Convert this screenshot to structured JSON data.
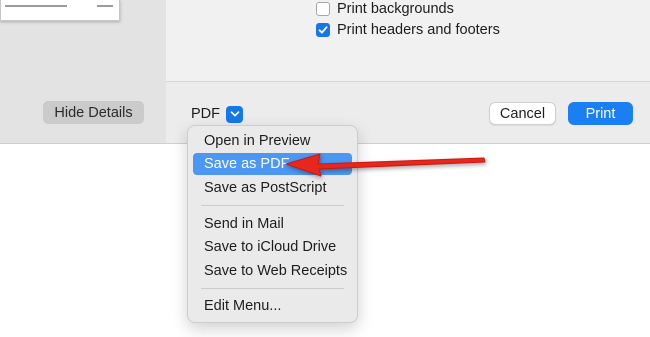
{
  "print_options": {
    "items": [
      {
        "label": "Print backgrounds",
        "checked": false
      },
      {
        "label": "Print headers and footers",
        "checked": true
      }
    ]
  },
  "footer": {
    "hide_details_label": "Hide Details",
    "pdf_label": "PDF",
    "cancel_label": "Cancel",
    "print_label": "Print"
  },
  "pdf_menu": {
    "items": [
      {
        "label": "Open in Preview",
        "selected": false
      },
      {
        "label": "Save as PDF",
        "selected": true
      },
      {
        "label": "Save as PostScript",
        "selected": false
      },
      {
        "label": "Send in Mail",
        "selected": false
      },
      {
        "label": "Save to iCloud Drive",
        "selected": false
      },
      {
        "label": "Save to Web Receipts",
        "selected": false
      },
      {
        "label": "Edit Menu...",
        "selected": false
      }
    ]
  },
  "icons": {
    "checkmark": "checkmark-icon",
    "pdf_caret": "chevron-down-icon",
    "annotation": "red-arrow-icon"
  },
  "colors": {
    "accent": "#1677e8",
    "menu_highlight": "#4c97f3",
    "annotation_arrow": "#e8261c"
  }
}
